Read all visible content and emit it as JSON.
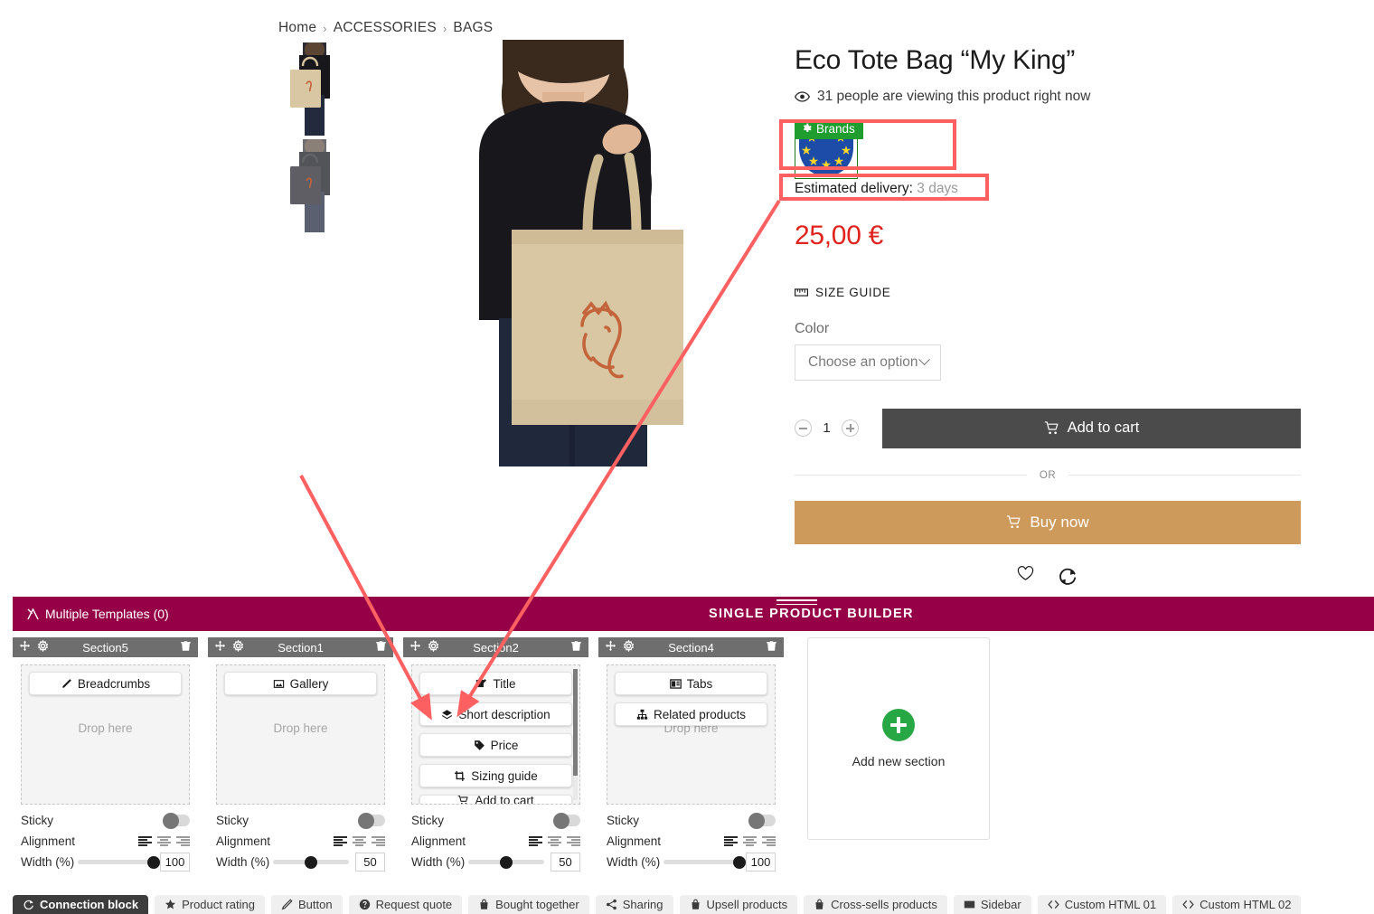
{
  "colors": {
    "builder_bar": "#960047",
    "badge_green": "#1f9d2f",
    "price_red": "#e0231d",
    "addcart_gray": "#4b4b4b",
    "buynow_tan": "#cd9a5b",
    "annotation_red": "#fc6060",
    "add_section_green": "#28a745"
  },
  "breadcrumb": {
    "items": [
      "Home",
      "ACCESSORIES",
      "BAGS"
    ],
    "separator": "›"
  },
  "gallery": {
    "thumbs": [
      {
        "name": "tote-beige-thumb",
        "alt": "Woman holding beige eco tote bag"
      },
      {
        "name": "tote-dark-thumb",
        "alt": "Woman holding dark grey eco tote bag"
      }
    ],
    "hero_alt": "Woman holding beige eco tote bag with lion crown print"
  },
  "product": {
    "title": "Eco Tote Bag “My King”",
    "viewers_text": "31 people are viewing this product right now",
    "viewers_icon": "eye-icon",
    "brands_badge": "Brands",
    "brands_badge_icon": "gear-icon",
    "brand_flag_alt": "European Union flag brand image",
    "delivery_label": "Estimated delivery:",
    "delivery_value": "3 days",
    "price": "25,00 €",
    "size_guide": "SIZE GUIDE",
    "size_guide_icon": "ruler-icon",
    "color_label": "Color",
    "color_selected": "Choose an option",
    "color_chevron_icon": "chevron-down-icon",
    "quantity": "1",
    "qty_minus_icon": "minus-circle-icon",
    "qty_plus_icon": "plus-circle-icon",
    "add_to_cart": "Add to cart",
    "cart_icon": "shopping-cart-icon",
    "or_text": "OR",
    "buy_now": "Buy now",
    "wishlist_icon": "heart-icon",
    "compare_icon": "compare-refresh-icon"
  },
  "builder": {
    "multiple_templates": "Multiple Templates (0)",
    "multiple_templates_icon": "templates-icon",
    "title": "SINGLE PRODUCT BUILDER",
    "grip_icon": "drag-handle-icon",
    "move_icon": "move-arrows-icon",
    "settings_icon": "gear-icon",
    "delete_icon": "trash-icon",
    "drop_text": "Drop here",
    "sticky_label": "Sticky",
    "alignment_label": "Alignment",
    "width_label": "Width (%)",
    "add_section_label": "Add new section",
    "sections": [
      {
        "name": "Section5",
        "blocks": [
          {
            "label": "Breadcrumbs",
            "icon": "breadcrumb-pen-icon",
            "clipped": false
          }
        ],
        "show_drop_text": true,
        "scrollbar": false,
        "sticky": false,
        "alignment": "left",
        "width": "100"
      },
      {
        "name": "Section1",
        "blocks": [
          {
            "label": "Gallery",
            "icon": "gallery-images-icon",
            "clipped": false
          }
        ],
        "show_drop_text": true,
        "scrollbar": false,
        "sticky": false,
        "alignment": "left",
        "width": "50"
      },
      {
        "name": "Section2",
        "blocks": [
          {
            "label": "Title",
            "icon": "title-edit-icon",
            "clipped": false
          },
          {
            "label": "Short description",
            "icon": "short-description-icon",
            "clipped": false
          },
          {
            "label": "Price",
            "icon": "price-tag-icon",
            "clipped": false
          },
          {
            "label": "Sizing guide",
            "icon": "sizing-guide-icon",
            "clipped": false
          },
          {
            "label": "Add to cart",
            "icon": "shopping-cart-icon",
            "clipped": true
          }
        ],
        "show_drop_text": false,
        "scrollbar": true,
        "sticky": false,
        "alignment": "left",
        "width": "50"
      },
      {
        "name": "Section4",
        "blocks": [
          {
            "label": "Tabs",
            "icon": "tabs-icon",
            "clipped": false
          },
          {
            "label": "Related products",
            "icon": "sitemap-icon",
            "clipped": false
          }
        ],
        "show_drop_text": true,
        "scrollbar": false,
        "sticky": false,
        "alignment": "left",
        "width": "100"
      }
    ]
  },
  "palette": {
    "items": [
      {
        "label": "Connection block",
        "icon": "connection-refresh-icon",
        "active": true
      },
      {
        "label": "Product rating",
        "icon": "star-icon",
        "active": false
      },
      {
        "label": "Button",
        "icon": "button-pen-icon",
        "active": false
      },
      {
        "label": "Request quote",
        "icon": "question-circle-icon",
        "active": false
      },
      {
        "label": "Bought together",
        "icon": "bag-icon",
        "active": false
      },
      {
        "label": "Sharing",
        "icon": "share-icon",
        "active": false
      },
      {
        "label": "Upsell products",
        "icon": "bag-icon",
        "active": false
      },
      {
        "label": "Cross-sells products",
        "icon": "bag-icon",
        "active": false
      },
      {
        "label": "Sidebar",
        "icon": "sidebar-icon",
        "active": false
      },
      {
        "label": "Custom HTML 01",
        "icon": "code-icon",
        "active": false
      },
      {
        "label": "Custom HTML 02",
        "icon": "code-icon",
        "active": false
      }
    ]
  },
  "annotations": {
    "box1_label": "highlight around Brands badge row",
    "box2_label": "highlight around brand flag bottom row",
    "arrow1_label": "arrow from storefront badge to Short description block",
    "arrow2_label": "arrow from left preview area to Short description block"
  }
}
